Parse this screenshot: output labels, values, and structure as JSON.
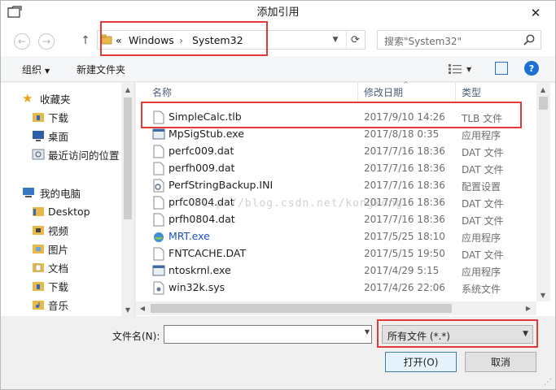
{
  "window": {
    "title": "添加引用",
    "close": "✕"
  },
  "nav": {
    "back": "←",
    "forward": "→",
    "up": "↑",
    "breadcrumb_sep": "«",
    "breadcrumbs": [
      "Windows",
      "System32"
    ],
    "breadcrumb_arrow": "›",
    "search_placeholder": "搜索\"System32\""
  },
  "toolbar": {
    "organize": "组织",
    "new_folder": "新建文件夹"
  },
  "sidebar": {
    "items": [
      {
        "label": "收藏夹",
        "icon": "star-icon"
      },
      {
        "label": "下载",
        "icon": "downloads-folder-icon"
      },
      {
        "label": "桌面",
        "icon": "desktop-icon"
      },
      {
        "label": "最近访问的位置",
        "icon": "recent-places-icon"
      },
      {
        "label": "我的电脑",
        "icon": "computer-icon"
      },
      {
        "label": "Desktop",
        "icon": "folder-icon"
      },
      {
        "label": "视频",
        "icon": "videos-folder-icon"
      },
      {
        "label": "图片",
        "icon": "pictures-folder-icon"
      },
      {
        "label": "文档",
        "icon": "documents-folder-icon"
      },
      {
        "label": "下载",
        "icon": "downloads-folder-icon"
      },
      {
        "label": "音乐",
        "icon": "music-folder-icon"
      }
    ]
  },
  "columns": {
    "name": "名称",
    "modified": "修改日期",
    "type": "类型"
  },
  "files": [
    {
      "name": "SimpleCalc.tlb",
      "date": "2017/9/10 14:26",
      "type": "TLB 文件",
      "icon": "document-icon"
    },
    {
      "name": "MpSigStub.exe",
      "date": "2017/8/18 0:35",
      "type": "应用程序",
      "icon": "exe-icon"
    },
    {
      "name": "perfc009.dat",
      "date": "2017/7/16 18:36",
      "type": "DAT 文件",
      "icon": "document-icon"
    },
    {
      "name": "perfh009.dat",
      "date": "2017/7/16 18:36",
      "type": "DAT 文件",
      "icon": "document-icon"
    },
    {
      "name": "PerfStringBackup.INI",
      "date": "2017/7/16 18:36",
      "type": "配置设置",
      "icon": "settings-file-icon"
    },
    {
      "name": "prfc0804.dat",
      "date": "2017/7/16 18:36",
      "type": "DAT 文件",
      "icon": "document-icon"
    },
    {
      "name": "prfh0804.dat",
      "date": "2017/7/16 18:36",
      "type": "DAT 文件",
      "icon": "document-icon"
    },
    {
      "name": "MRT.exe",
      "date": "2017/5/25 18:10",
      "type": "应用程序",
      "icon": "mrt-icon"
    },
    {
      "name": "FNTCACHE.DAT",
      "date": "2017/5/15 19:50",
      "type": "DAT 文件",
      "icon": "document-icon"
    },
    {
      "name": "ntoskrnl.exe",
      "date": "2017/4/29 5:15",
      "type": "应用程序",
      "icon": "exe-icon"
    },
    {
      "name": "win32k.sys",
      "date": "2017/4/26 22:06",
      "type": "系统文件",
      "icon": "system-file-icon"
    }
  ],
  "watermark": "http://blog.csdn.net/kongkong",
  "bottom": {
    "filename_label": "文件名(N):",
    "filename_value": "",
    "filter_value": "所有文件 (*.*)",
    "open": "打开(O)",
    "cancel": "取消"
  },
  "colors": {
    "highlight_box": "#e23a3a",
    "link_file": "#1c4fc2"
  }
}
